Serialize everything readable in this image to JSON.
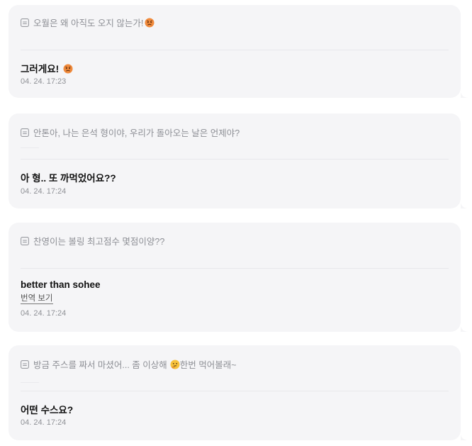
{
  "cards": [
    {
      "question": "오월은 왜 아직도 오지 않는가!",
      "question_emoji": "angry-face-emoji",
      "answer": "그러게요!",
      "answer_emoji": "angry-face-emoji",
      "time": "04. 24. 17:23"
    },
    {
      "question": "안톤아, 나는 은석 형이야, 우리가 돌아오는 날은 언제야?",
      "answer": "아 형.. 또 까먹었어요??",
      "time": "04. 24. 17:24"
    },
    {
      "question": "찬영이는 볼링 최고점수 몇점이양??",
      "answer": "better than sohee",
      "translate_label": "번역 보기",
      "time": "04. 24. 17:24"
    },
    {
      "question_part1": "방금 주스를 짜서 마셨어... 좀 이상해",
      "question_part2": " 한번 먹어볼래~",
      "question_emoji": "thinking-face-emoji",
      "answer": "어떤 수스요?",
      "time": "04. 24. 17:24"
    }
  ],
  "colors": {
    "card_bg": "#f5f5f7",
    "question_text": "#8d8f95",
    "answer_text": "#111111",
    "time_text": "#8f9196"
  }
}
